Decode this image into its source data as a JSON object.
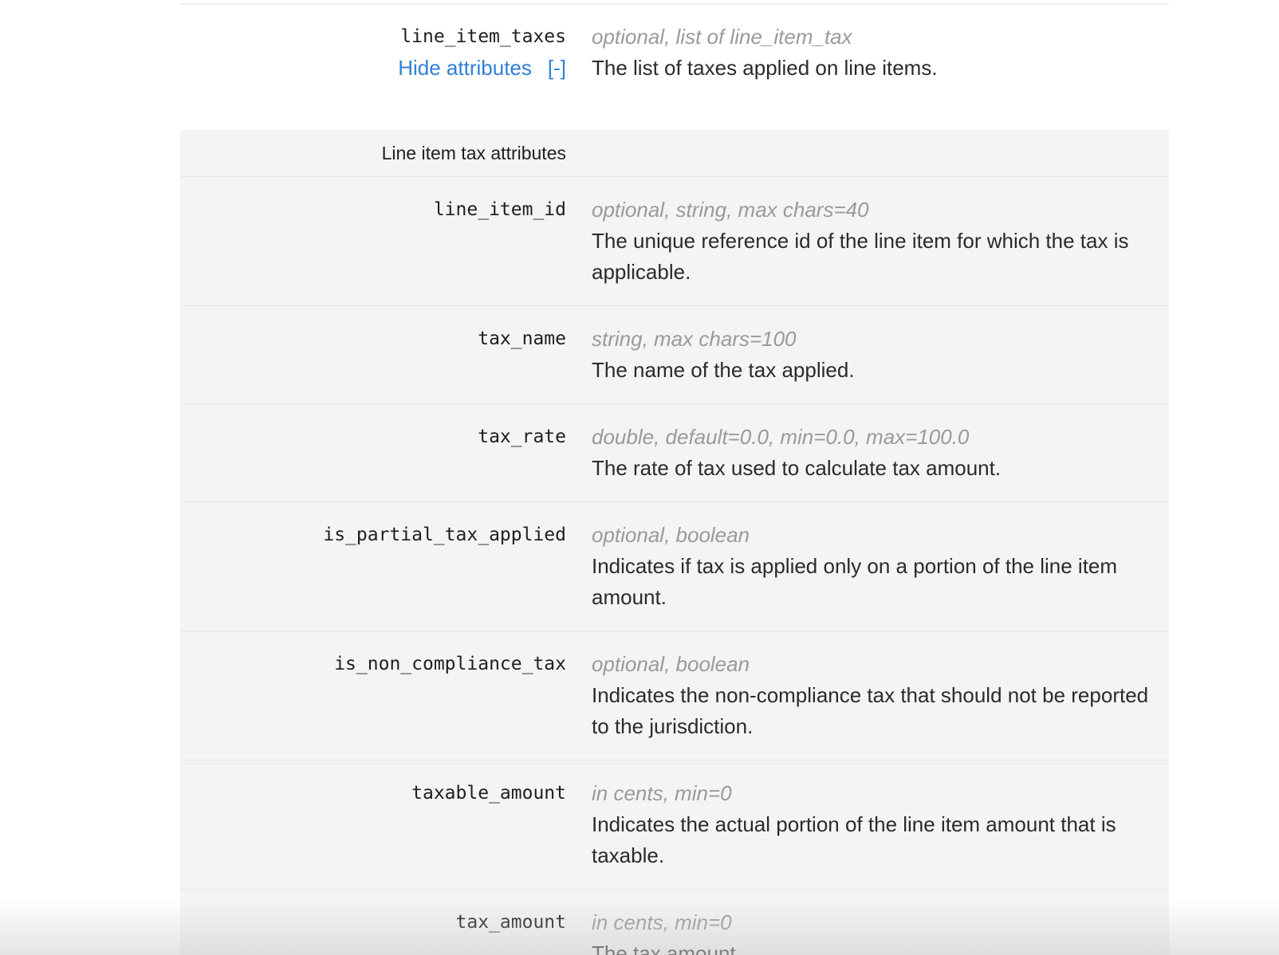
{
  "parent_attribute": {
    "name": "line_item_taxes",
    "type": "optional, list of line_item_tax",
    "description": "The list of taxes applied on line items.",
    "toggle_label": "Hide attributes",
    "toggle_bracket": "[-]"
  },
  "child_panel": {
    "title": "Line item tax attributes",
    "attributes": [
      {
        "name": "line_item_id",
        "type": "optional, string, max chars=40",
        "description": "The unique reference id of the line item for which the tax is applicable."
      },
      {
        "name": "tax_name",
        "type": "string, max chars=100",
        "description": "The name of the tax applied."
      },
      {
        "name": "tax_rate",
        "type": "double, default=0.0, min=0.0, max=100.0",
        "description": "The rate of tax used to calculate tax amount."
      },
      {
        "name": "is_partial_tax_applied",
        "type": "optional, boolean",
        "description": "Indicates if tax is applied only on a portion of the line item amount."
      },
      {
        "name": "is_non_compliance_tax",
        "type": "optional, boolean",
        "description": "Indicates the non-compliance tax that should not be reported to the jurisdiction."
      },
      {
        "name": "taxable_amount",
        "type": "in cents, min=0",
        "description": "Indicates the actual portion of the line item amount that is taxable."
      },
      {
        "name": "tax_amount",
        "type": "in cents, min=0",
        "description": "The tax amount."
      }
    ]
  }
}
